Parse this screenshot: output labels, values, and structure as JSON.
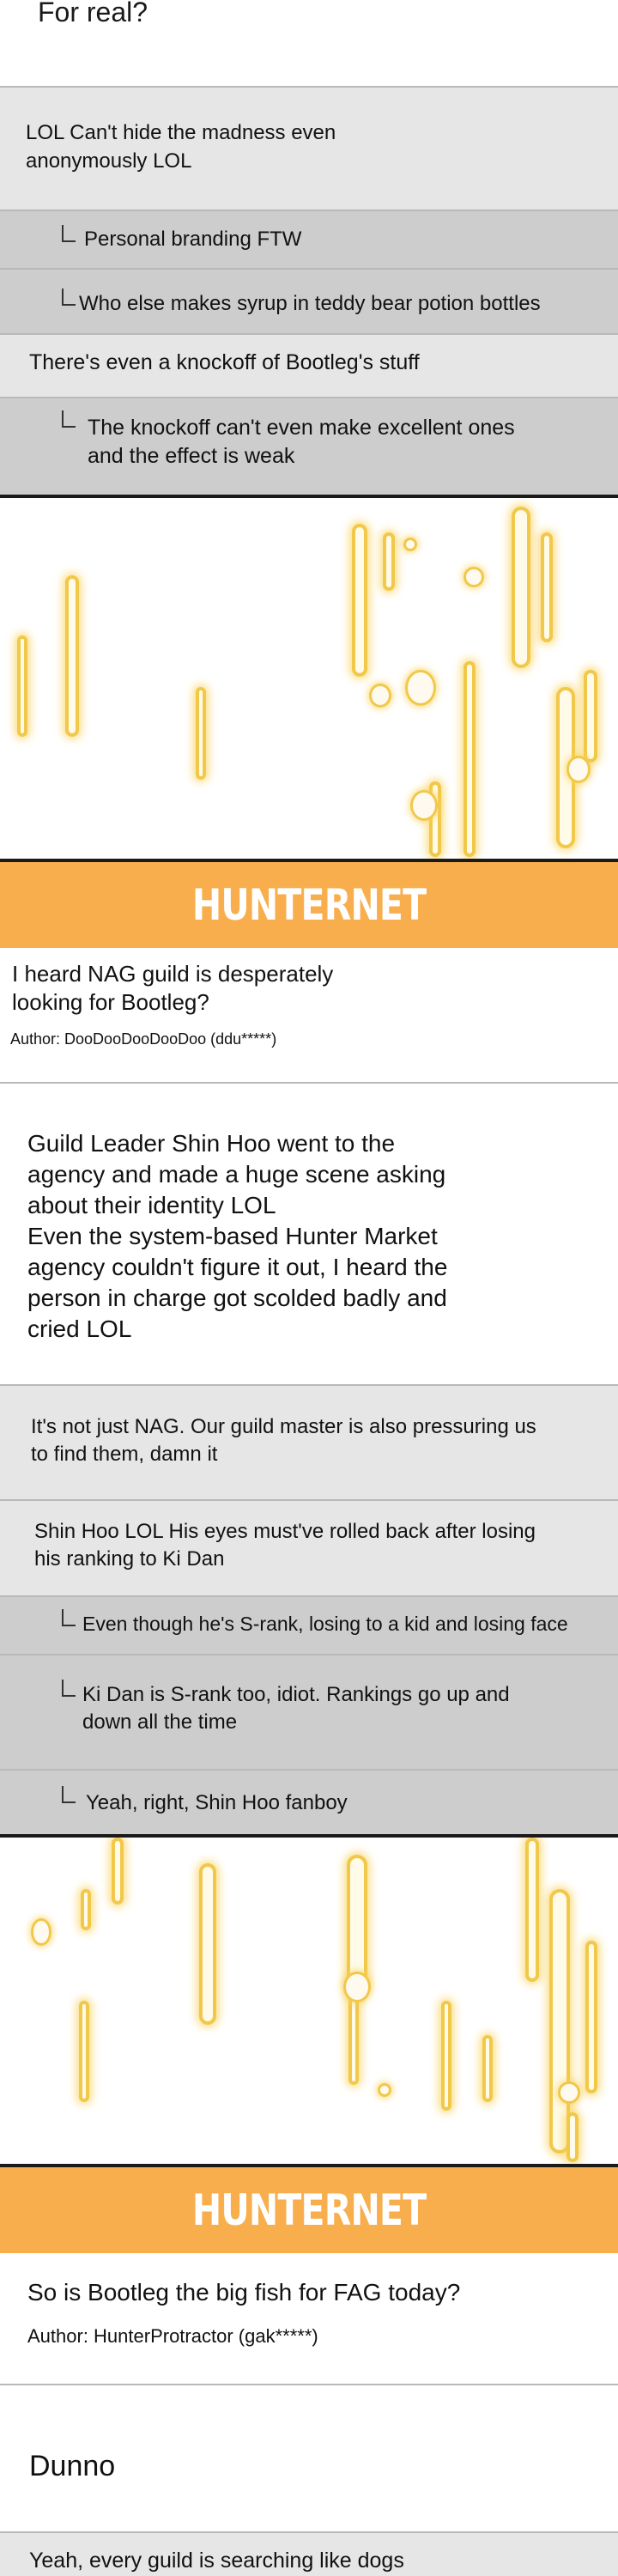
{
  "top_title": "For real?",
  "thread1": {
    "comment1": "LOL Can't hide the madness even\nanonymously LOL",
    "reply1": "Personal branding FTW",
    "reply2": "Who else makes syrup in teddy bear potion bottles",
    "comment2": "There's even a knockoff of Bootleg's stuff",
    "reply3": "The knockoff can't even make excellent ones\nand the effect is weak"
  },
  "banner_text": "HUNTERNET",
  "post1": {
    "title": "I heard NAG guild is desperately\nlooking for Bootleg?",
    "author": "Author: DooDooDooDooDoo (ddu*****)",
    "body": "Guild Leader Shin Hoo went to the\nagency and made a huge scene asking\nabout their identity LOL\nEven the system-based Hunter Market\nagency couldn't figure it out, I heard the\nperson in charge got scolded badly and\ncried LOL",
    "comment1": "It's not just NAG. Our guild master is also pressuring us\nto find them, damn it",
    "comment2": "Shin Hoo LOL His eyes must've rolled back after losing\nhis ranking to Ki Dan",
    "reply1": "Even though he's S-rank, losing to a kid and losing face",
    "reply2": "Ki Dan is S-rank too, idiot. Rankings go up and\ndown all the time",
    "reply3": "Yeah, right, Shin Hoo fanboy"
  },
  "post2": {
    "title": "So is Bootleg the big fish for FAG today?",
    "author": "Author: HunterProtractor (gak*****)",
    "body": "Dunno",
    "comment1": "Yeah, every guild is searching like dogs"
  },
  "colors": {
    "banner": "#f8ae4c",
    "comment_bg": "#e6e6e6",
    "reply_bg": "#cdcdcd",
    "glow": "#f2c84a"
  }
}
